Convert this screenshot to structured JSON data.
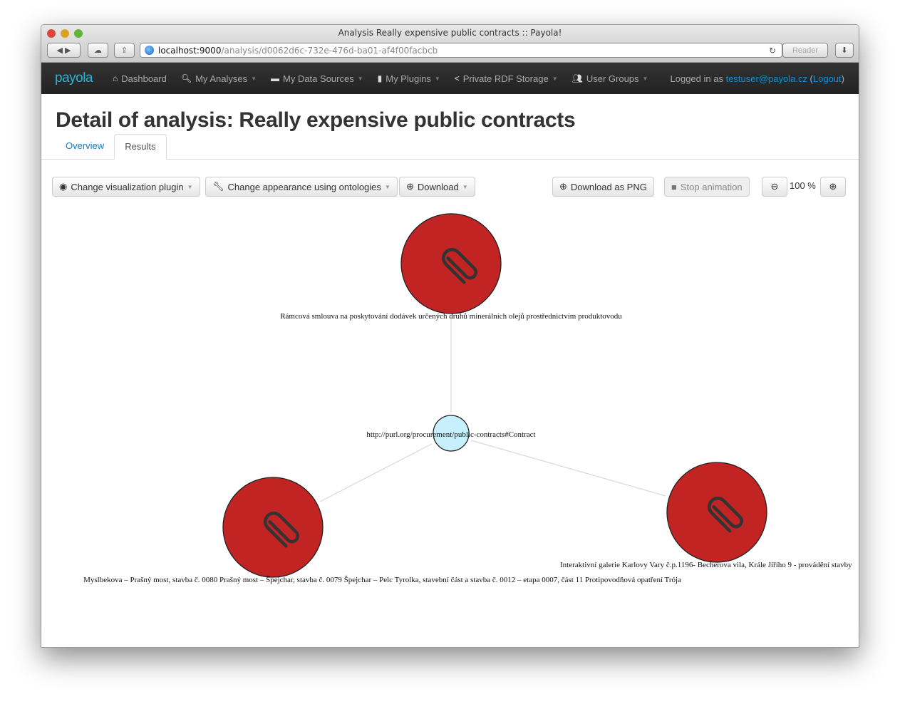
{
  "browser": {
    "title": "Analysis Really expensive public contracts :: Payola!",
    "url_host": "localhost:9000",
    "url_path": "/analysis/d0062d6c-732e-476d-ba01-af4f00facbcb",
    "reader": "Reader"
  },
  "nav": {
    "logo": "payola",
    "items": [
      {
        "label": "Dashboard",
        "icon": "home-icon",
        "caret": false
      },
      {
        "label": "My Analyses",
        "icon": "search-icon",
        "caret": true
      },
      {
        "label": "My Data Sources",
        "icon": "storage-icon",
        "caret": true
      },
      {
        "label": "My Plugins",
        "icon": "file-icon",
        "caret": true
      },
      {
        "label": "Private RDF Storage",
        "icon": "share-icon",
        "caret": true
      },
      {
        "label": "User Groups",
        "icon": "users-icon",
        "caret": true
      }
    ],
    "logged_prefix": "Logged in as ",
    "user": "testuser@payola.cz",
    "logout": "Logout"
  },
  "page": {
    "title": "Detail of analysis: Really expensive public contracts",
    "tabs": [
      "Overview",
      "Results"
    ],
    "active_tab": "Results"
  },
  "toolbar": {
    "change_plugin": "Change visualization plugin",
    "change_appearance": "Change appearance using ontologies",
    "download": "Download",
    "download_png": "Download as PNG",
    "stop_animation": "Stop animation",
    "zoom": "100 %"
  },
  "graph": {
    "colors": {
      "contract": "#c22424",
      "class": "#c6f0fb",
      "edge": "#d8d8d8"
    },
    "nodes": [
      {
        "label": "Rámcová smlouva na poskytování dodávek určených druhů minerálních olejů prostřednictvím produktovodu",
        "icon": "paperclip-icon"
      },
      {
        "label": "http://purl.org/procurement/public-contracts#Contract"
      },
      {
        "label": "Myslbekova – Prašný most, stavba č. 0080 Prašný most – Špejchar, stavba č. 0079 Špejchar – Pelc Tyrolka, stavební část a stavba č. 0012 – etapa 0007, část 11 Protipovodňová opatření Trója",
        "icon": "paperclip-icon"
      },
      {
        "label": "Interaktivní galerie Karlovy Vary č.p.1196- Becherova vila, Krále Jiřího 9 - provádění stavby",
        "icon": "paperclip-icon"
      }
    ]
  }
}
